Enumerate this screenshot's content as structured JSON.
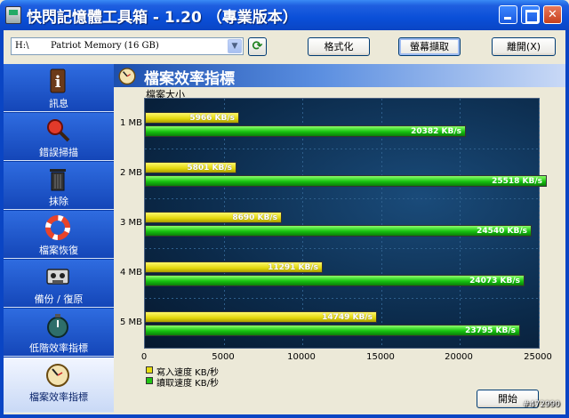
{
  "window": {
    "title": "快閃記憶體工具箱 - 1.20 （專業版本）",
    "min_symbol": "",
    "max_symbol": "",
    "close_symbol": "✕"
  },
  "toolbar": {
    "drive_letter": "H:\\",
    "drive_name": "Patriot Memory (16 GB)",
    "format_label": "格式化",
    "screenshot_label": "螢幕擷取",
    "exit_label": "離開(X)"
  },
  "sidebar": {
    "items": [
      {
        "label": "訊息",
        "icon": "info-icon"
      },
      {
        "label": "錯誤掃描",
        "icon": "magnifier-icon"
      },
      {
        "label": "抹除",
        "icon": "trash-icon"
      },
      {
        "label": "檔案恢復",
        "icon": "lifebuoy-icon"
      },
      {
        "label": "備份 / 復原",
        "icon": "tape-icon"
      },
      {
        "label": "低階效率指標",
        "icon": "stopwatch-icon"
      },
      {
        "label": "檔案效率指標",
        "icon": "clock-icon",
        "active": true
      }
    ]
  },
  "panel": {
    "title": "檔案效率指標",
    "start_label": "開始"
  },
  "chart_data": {
    "type": "bar",
    "orientation": "horizontal",
    "title": "",
    "ylabel": "檔案大小",
    "xlabel": "",
    "categories": [
      "1 MB",
      "2 MB",
      "3 MB",
      "4 MB",
      "5 MB"
    ],
    "series": [
      {
        "name": "寫入速度 KB/秒",
        "color": "#e6dc10",
        "values": [
          5966,
          5801,
          8690,
          11291,
          14749
        ]
      },
      {
        "name": "讀取速度 KB/秒",
        "color": "#22c414",
        "values": [
          20382,
          25518,
          24540,
          24073,
          23795
        ]
      }
    ],
    "value_labels": {
      "write": [
        "5966 KB/s",
        "5801 KB/s",
        "8690 KB/s",
        "11291 KB/s",
        "14749 KB/s"
      ],
      "read": [
        "20382 KB/s",
        "25518 KB/s",
        "24540 KB/s",
        "24073 KB/s",
        "23795 KB/s"
      ]
    },
    "xlim": [
      0,
      25000
    ],
    "xticks": [
      "0",
      "5000",
      "10000",
      "15000",
      "20000",
      "25000"
    ],
    "grid": true,
    "legend_position": "bottom-left"
  },
  "watermark": "#472990"
}
